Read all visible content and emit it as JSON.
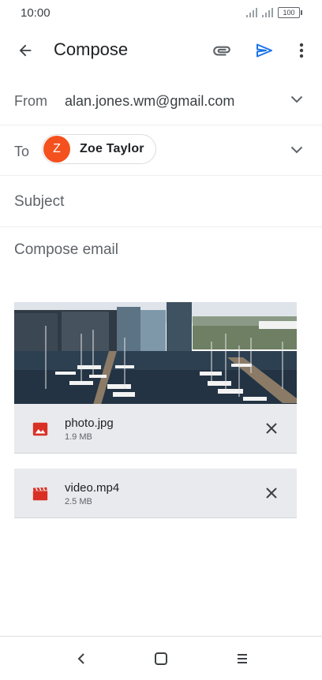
{
  "status": {
    "time": "10:00",
    "battery": "100",
    "signal_icon": "signal-icon"
  },
  "app_bar": {
    "title": "Compose",
    "back_icon": "arrow-back-icon",
    "attach_icon": "paperclip-icon",
    "send_icon": "send-icon",
    "more_icon": "more-vert-icon",
    "send_color": "#1a73e8"
  },
  "from": {
    "label": "From",
    "value": "alan.jones.wm@gmail.com"
  },
  "to": {
    "label": "To",
    "recipient": {
      "initial": "Z",
      "name": "Zoe Taylor",
      "avatar_color": "#f4511e"
    }
  },
  "subject": {
    "placeholder": "Subject",
    "value": ""
  },
  "body": {
    "placeholder": "Compose email",
    "value": ""
  },
  "attachments": [
    {
      "name": "photo.jpg",
      "size": "1.9 MB",
      "icon": "image-icon",
      "icon_color": "#d93025"
    },
    {
      "name": "video.mp4",
      "size": "2.5 MB",
      "icon": "video-clapper-icon",
      "icon_color": "#d93025"
    }
  ],
  "nav": {
    "back_icon": "nav-back-icon",
    "home_icon": "nav-home-icon",
    "recents_icon": "nav-menu-icon"
  }
}
